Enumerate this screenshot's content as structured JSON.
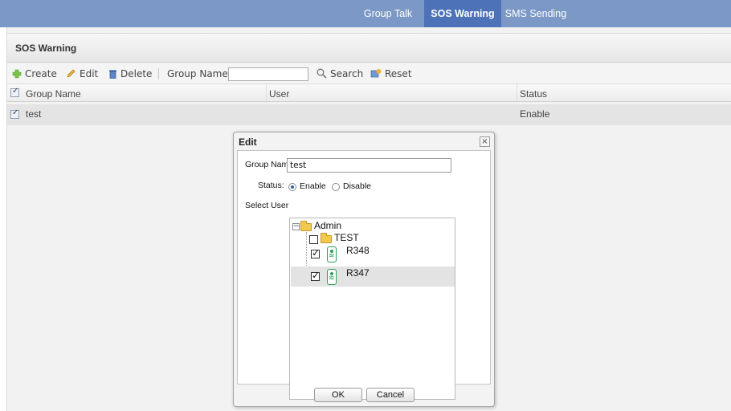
{
  "nav": {
    "tabs": [
      {
        "label": "Group Talk",
        "active": false
      },
      {
        "label": "SOS Warning",
        "active": true
      },
      {
        "label": "SMS Sending",
        "active": false
      }
    ]
  },
  "panel": {
    "title": "SOS Warning"
  },
  "toolbar": {
    "create_label": "Create",
    "edit_label": "Edit",
    "delete_label": "Delete",
    "group_name_label": "Group Name:",
    "group_name_value": "",
    "search_label": "Search",
    "reset_label": "Reset"
  },
  "grid": {
    "columns": [
      "Group Name",
      "User",
      "Status"
    ],
    "rows": [
      {
        "group_name": "test",
        "user": "",
        "status": "Enable"
      }
    ]
  },
  "dialog": {
    "title": "Edit",
    "close_glyph": "×",
    "group_name_label": "Group Nam",
    "group_name_value": "test",
    "status_label": "Status:",
    "status_options": [
      "Enable",
      "Disable"
    ],
    "status_selected": "Enable",
    "select_user_label": "Select User",
    "tree": {
      "root": "Admin",
      "children": [
        {
          "label": "TEST",
          "type": "folder",
          "checked": false
        },
        {
          "label": "R348",
          "type": "radio",
          "checked": true
        },
        {
          "label": "R347",
          "type": "radio",
          "checked": true
        }
      ]
    },
    "ok_label": "OK",
    "cancel_label": "Cancel"
  },
  "colors": {
    "nav_bg": "#7c98c6",
    "nav_active": "#4d72b8",
    "device_icon": "#27a05a"
  }
}
